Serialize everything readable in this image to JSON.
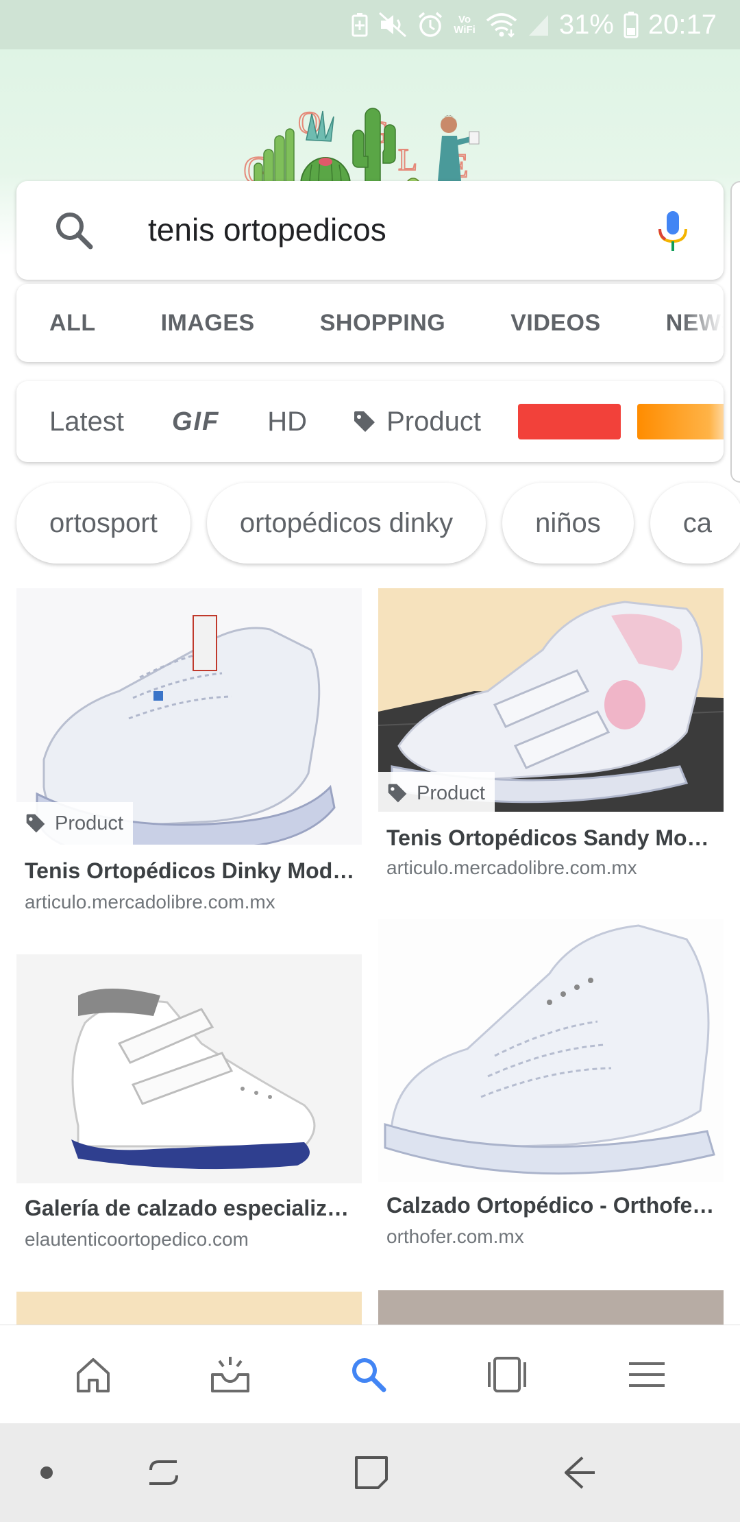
{
  "status_bar": {
    "battery": "31%",
    "time": "20:17",
    "icons": [
      "battery-saver-icon",
      "mute-icon",
      "alarm-icon",
      "vowifi-icon",
      "wifi-icon",
      "signal-icon",
      "battery-icon"
    ],
    "vowifi_label_top": "Vo",
    "vowifi_label_bottom": "WiFi"
  },
  "doodle": {
    "letters": [
      "G",
      "O",
      "O",
      "G",
      "L",
      "E"
    ]
  },
  "search": {
    "query": "tenis ortopedicos",
    "search_icon": "search-icon",
    "mic_icon": "microphone-icon"
  },
  "tabs": [
    {
      "label": "ALL"
    },
    {
      "label": "IMAGES"
    },
    {
      "label": "SHOPPING"
    },
    {
      "label": "VIDEOS"
    },
    {
      "label": "NEWS"
    }
  ],
  "filters": {
    "latest": "Latest",
    "gif": "GIF",
    "hd": "HD",
    "product": "Product",
    "color_swatches": [
      "#f2413a",
      "#ff8c00"
    ]
  },
  "chips": [
    "ortosport",
    "ortopédicos dinky",
    "niños",
    "ca"
  ],
  "results": [
    {
      "title": "Tenis Ortopédicos Dinky Mod…",
      "source": "articulo.mercadolibre.com.mx",
      "badge": "Product"
    },
    {
      "title": "Tenis Ortopédicos Sandy Mo…",
      "source": "articulo.mercadolibre.com.mx",
      "badge": "Product"
    },
    {
      "title": "Galería de calzado especializ…",
      "source": "elautenticoortopedico.com",
      "badge": ""
    },
    {
      "title": "Calzado Ortopédico - Orthofe…",
      "source": "orthofer.com.mx",
      "badge": ""
    }
  ],
  "bottom_nav": [
    "home-icon",
    "updates-icon",
    "search-icon",
    "tabs-icon",
    "menu-icon"
  ],
  "system_nav": [
    "dot-icon",
    "recents-icon",
    "home-square-icon",
    "back-icon"
  ],
  "colors": {
    "status_bar": "#cfe3d4",
    "accent_blue": "#4285f4",
    "text_gray": "#5f6368"
  }
}
